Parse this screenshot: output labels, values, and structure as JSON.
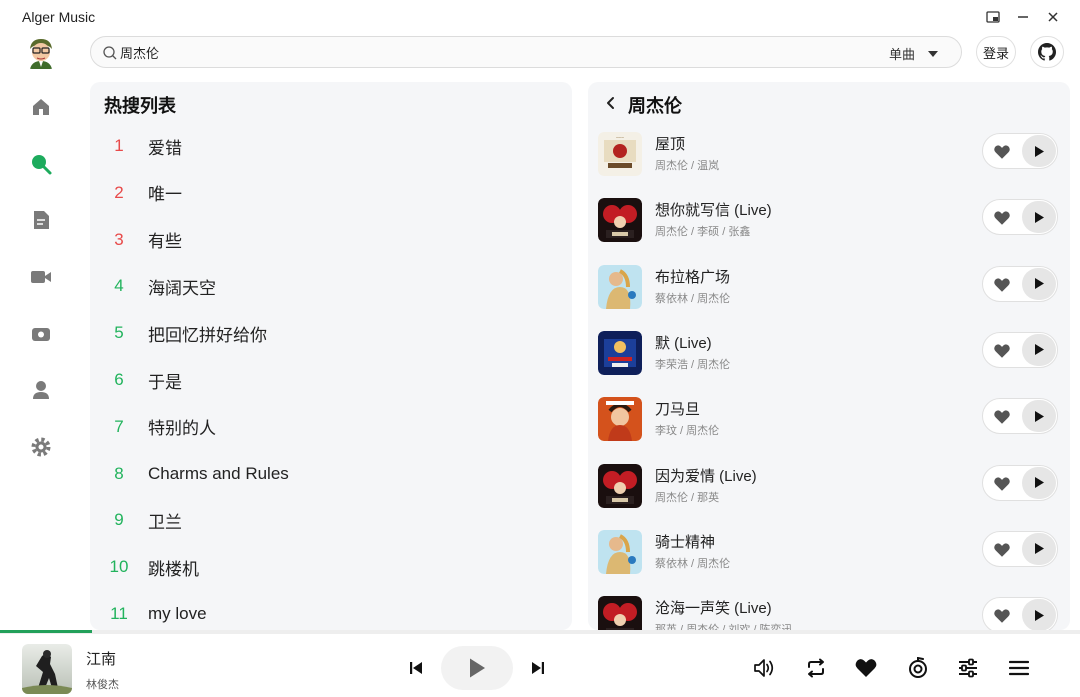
{
  "app": {
    "title": "Alger Music"
  },
  "search": {
    "query": "周杰伦",
    "type_label": "单曲"
  },
  "header": {
    "login_label": "登录"
  },
  "hot": {
    "title": "热搜列表",
    "items": [
      {
        "rank": "1",
        "text": "爱错"
      },
      {
        "rank": "2",
        "text": "唯一"
      },
      {
        "rank": "3",
        "text": "有些"
      },
      {
        "rank": "4",
        "text": "海阔天空"
      },
      {
        "rank": "5",
        "text": "把回忆拼好给你"
      },
      {
        "rank": "6",
        "text": "于是"
      },
      {
        "rank": "7",
        "text": "特别的人"
      },
      {
        "rank": "8",
        "text": "Charms and Rules"
      },
      {
        "rank": "9",
        "text": "卫兰"
      },
      {
        "rank": "10",
        "text": "跳楼机"
      },
      {
        "rank": "11",
        "text": "my love"
      }
    ]
  },
  "results": {
    "title": "周杰伦",
    "songs": [
      {
        "title": "屋顶",
        "artist": "周杰伦 / 温岚"
      },
      {
        "title": "想你就写信 (Live)",
        "artist": "周杰伦 / 李硕 / 张鑫"
      },
      {
        "title": "布拉格广场",
        "artist": "蔡依林 / 周杰伦"
      },
      {
        "title": "默 (Live)",
        "artist": "李荣浩 / 周杰伦"
      },
      {
        "title": "刀马旦",
        "artist": "李玟 / 周杰伦"
      },
      {
        "title": "因为爱情 (Live)",
        "artist": "周杰伦 / 那英"
      },
      {
        "title": "骑士精神",
        "artist": "蔡依林 / 周杰伦"
      },
      {
        "title": "沧海一声笑 (Live)",
        "artist": "那英 / 周杰伦 / 刘欢 / 陈奕迅"
      }
    ]
  },
  "player": {
    "title": "江南",
    "artist": "林俊杰",
    "progress": 0.085
  },
  "colors": {
    "accent": "#22a05a",
    "rank_top": "#e84a4a",
    "rank_normal": "#22b35d"
  }
}
